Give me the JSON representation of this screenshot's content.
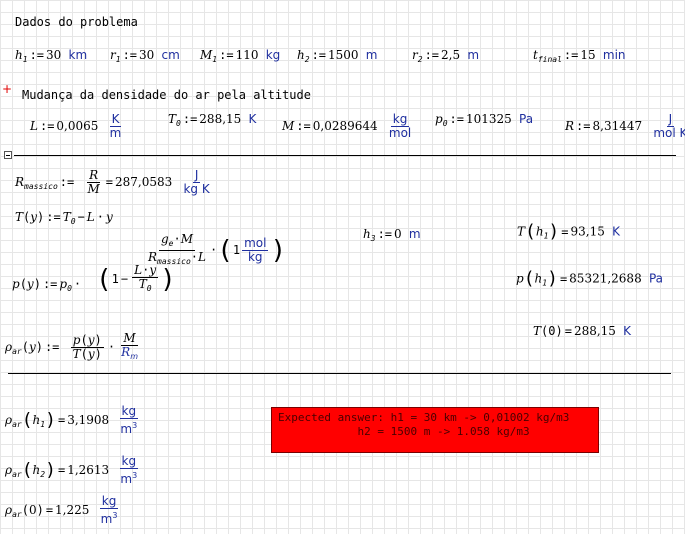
{
  "section1": {
    "title": "Dados do problema",
    "vars": [
      {
        "name": "h",
        "sub": "1",
        "value": "30",
        "unit": "km"
      },
      {
        "name": "r",
        "sub": "1",
        "value": "30",
        "unit": "cm"
      },
      {
        "name": "M",
        "sub": "1",
        "value": "110",
        "unit": "kg"
      },
      {
        "name": "h",
        "sub": "2",
        "value": "1500",
        "unit": "m"
      },
      {
        "name": "r",
        "sub": "2",
        "value": "2,5",
        "unit": "m"
      },
      {
        "name": "t",
        "sub": "final",
        "value": "15",
        "unit": "min"
      }
    ]
  },
  "section2": {
    "title": "Mudança da densidade do ar pela altitude",
    "L": {
      "value": "0,0065",
      "unit_num": "K",
      "unit_den": "m"
    },
    "T0": {
      "value": "288,15",
      "unit": "K"
    },
    "M": {
      "value": "0,0289644",
      "unit_num": "kg",
      "unit_den": "mol"
    },
    "p0": {
      "value": "101325",
      "unit": "Pa"
    },
    "R": {
      "value": "8,31447",
      "unit_num": "J",
      "unit_den": "mol K"
    }
  },
  "section3": {
    "rmassico_value": "287,0583",
    "rmassico_unit_num": "J",
    "rmassico_unit_den": "kg K",
    "h3_value": "0",
    "h3_unit": "m",
    "T_h1_value": "93,15",
    "T_h1_unit": "K",
    "p_h1_value": "85321,2688",
    "p_h1_unit": "Pa",
    "T0_eval_value": "288,15",
    "T0_eval_unit": "K",
    "mol_unit": "mol",
    "kg_unit": "kg"
  },
  "results": [
    {
      "arg": "h",
      "argsub": "1",
      "value": "3,1908"
    },
    {
      "arg": "h",
      "argsub": "2",
      "value": "1,2613"
    },
    {
      "arg": "0",
      "argsub": "",
      "value": "1,225"
    }
  ],
  "result_unit": {
    "num": "kg",
    "den": "m",
    "exp": "3"
  },
  "expected": {
    "line1": "Expected answer: h1 = 30 km -> 0,01002 kg/m3",
    "line2": "            h2 = 1500 m -> 1.058 kg/m3"
  },
  "colors": {
    "unit": "#1f2f9f",
    "expected_bg": "#ff0000",
    "marker": "#e00000"
  }
}
